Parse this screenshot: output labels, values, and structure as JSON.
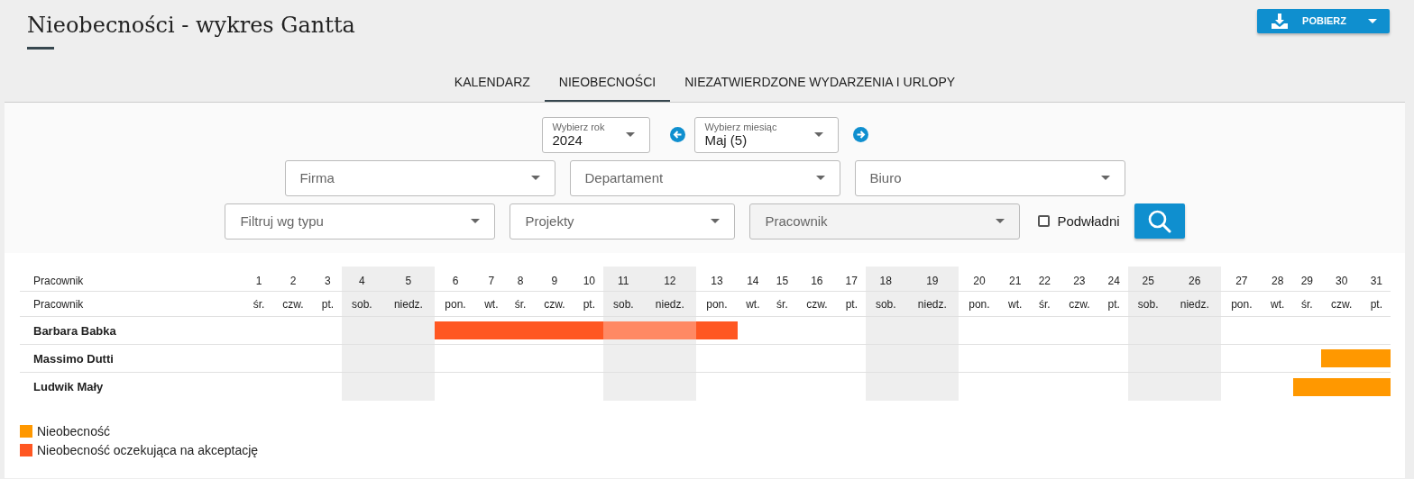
{
  "title": "Nieobecności - wykres Gantta",
  "download_button": {
    "label": "POBIERZ"
  },
  "tabs": [
    {
      "label": "KALENDARZ",
      "selected": false
    },
    {
      "label": "NIEOBECNOŚCI",
      "selected": true
    },
    {
      "label": "NIEZATWIERDZONE WYDARZENIA I URLOPY",
      "selected": false
    }
  ],
  "period": {
    "year": {
      "label": "Wybierz rok",
      "value": "2024"
    },
    "month": {
      "label": "Wybierz miesiąc",
      "value": "Maj (5)"
    }
  },
  "filters": [
    [
      {
        "placeholder": "Firma",
        "disabled": false
      },
      {
        "placeholder": "Departament",
        "disabled": false
      },
      {
        "placeholder": "Biuro",
        "disabled": false
      }
    ],
    [
      {
        "placeholder": "Filtruj wg typu",
        "disabled": false
      },
      {
        "placeholder": "Projekty",
        "disabled": false
      },
      {
        "placeholder": "Pracownik",
        "disabled": true
      }
    ]
  ],
  "subordinates": {
    "label": "Podwładni",
    "checked": false
  },
  "gantt": {
    "header_1": "Pracownik",
    "header_2": "Pracownik",
    "days": [
      {
        "day": "1",
        "weekday": "śr.",
        "weekend": false
      },
      {
        "day": "2",
        "weekday": "czw.",
        "weekend": false
      },
      {
        "day": "3",
        "weekday": "pt.",
        "weekend": false
      },
      {
        "day": "4",
        "weekday": "sob.",
        "weekend": true
      },
      {
        "day": "5",
        "weekday": "niedz.",
        "weekend": true
      },
      {
        "day": "6",
        "weekday": "pon.",
        "weekend": false
      },
      {
        "day": "7",
        "weekday": "wt.",
        "weekend": false
      },
      {
        "day": "8",
        "weekday": "śr.",
        "weekend": false
      },
      {
        "day": "9",
        "weekday": "czw.",
        "weekend": false
      },
      {
        "day": "10",
        "weekday": "pt.",
        "weekend": false
      },
      {
        "day": "11",
        "weekday": "sob.",
        "weekend": true
      },
      {
        "day": "12",
        "weekday": "niedz.",
        "weekend": true
      },
      {
        "day": "13",
        "weekday": "pon.",
        "weekend": false
      },
      {
        "day": "14",
        "weekday": "wt.",
        "weekend": false
      },
      {
        "day": "15",
        "weekday": "śr.",
        "weekend": false
      },
      {
        "day": "16",
        "weekday": "czw.",
        "weekend": false
      },
      {
        "day": "17",
        "weekday": "pt.",
        "weekend": false
      },
      {
        "day": "18",
        "weekday": "sob.",
        "weekend": true
      },
      {
        "day": "19",
        "weekday": "niedz.",
        "weekend": true
      },
      {
        "day": "20",
        "weekday": "pon.",
        "weekend": false
      },
      {
        "day": "21",
        "weekday": "wt.",
        "weekend": false
      },
      {
        "day": "22",
        "weekday": "śr.",
        "weekend": false
      },
      {
        "day": "23",
        "weekday": "czw.",
        "weekend": false
      },
      {
        "day": "24",
        "weekday": "pt.",
        "weekend": false
      },
      {
        "day": "25",
        "weekday": "sob.",
        "weekend": true
      },
      {
        "day": "26",
        "weekday": "niedz.",
        "weekend": true
      },
      {
        "day": "27",
        "weekday": "pon.",
        "weekend": false
      },
      {
        "day": "28",
        "weekday": "wt.",
        "weekend": false
      },
      {
        "day": "29",
        "weekday": "śr.",
        "weekend": false
      },
      {
        "day": "30",
        "weekday": "czw.",
        "weekend": false
      },
      {
        "day": "31",
        "weekday": "pt.",
        "weekend": false
      }
    ],
    "employees": [
      {
        "name": "Barbara Babka",
        "color": "#ff5722",
        "days": [
          {
            "absent": false
          },
          {
            "absent": false
          },
          {
            "absent": false
          },
          {
            "absent": false
          },
          {
            "absent": false
          },
          {
            "absent": true
          },
          {
            "absent": true
          },
          {
            "absent": true
          },
          {
            "absent": true
          },
          {
            "absent": true
          },
          {
            "absent": true
          },
          {
            "absent": true
          },
          {
            "absent": true
          },
          {
            "absent": false
          },
          {
            "absent": false
          },
          {
            "absent": false
          },
          {
            "absent": false
          },
          {
            "absent": false
          },
          {
            "absent": false
          },
          {
            "absent": false
          },
          {
            "absent": false
          },
          {
            "absent": false
          },
          {
            "absent": false
          },
          {
            "absent": false
          },
          {
            "absent": false
          },
          {
            "absent": false
          },
          {
            "absent": false
          },
          {
            "absent": false
          },
          {
            "absent": false
          },
          {
            "absent": false
          },
          {
            "absent": false
          }
        ]
      },
      {
        "name": "Massimo Dutti",
        "color": "#ff9800",
        "days": [
          {
            "absent": false
          },
          {
            "absent": false
          },
          {
            "absent": false
          },
          {
            "absent": false
          },
          {
            "absent": false
          },
          {
            "absent": false
          },
          {
            "absent": false
          },
          {
            "absent": false
          },
          {
            "absent": false
          },
          {
            "absent": false
          },
          {
            "absent": false
          },
          {
            "absent": false
          },
          {
            "absent": false
          },
          {
            "absent": false
          },
          {
            "absent": false
          },
          {
            "absent": false
          },
          {
            "absent": false
          },
          {
            "absent": false
          },
          {
            "absent": false
          },
          {
            "absent": false
          },
          {
            "absent": false
          },
          {
            "absent": false
          },
          {
            "absent": false
          },
          {
            "absent": false
          },
          {
            "absent": false
          },
          {
            "absent": false
          },
          {
            "absent": false
          },
          {
            "absent": false
          },
          {
            "absent": false
          },
          {
            "absent": true
          },
          {
            "absent": true
          }
        ]
      },
      {
        "name": "Ludwik Mały",
        "color": "#ff9800",
        "days": [
          {
            "absent": false
          },
          {
            "absent": false
          },
          {
            "absent": false
          },
          {
            "absent": false
          },
          {
            "absent": false
          },
          {
            "absent": false
          },
          {
            "absent": false
          },
          {
            "absent": false
          },
          {
            "absent": false
          },
          {
            "absent": false
          },
          {
            "absent": false
          },
          {
            "absent": false
          },
          {
            "absent": false
          },
          {
            "absent": false
          },
          {
            "absent": false
          },
          {
            "absent": false
          },
          {
            "absent": false
          },
          {
            "absent": false
          },
          {
            "absent": false
          },
          {
            "absent": false
          },
          {
            "absent": false
          },
          {
            "absent": false
          },
          {
            "absent": false
          },
          {
            "absent": false
          },
          {
            "absent": false
          },
          {
            "absent": false
          },
          {
            "absent": false
          },
          {
            "absent": false
          },
          {
            "absent": true
          },
          {
            "absent": true
          },
          {
            "absent": true
          }
        ]
      }
    ]
  },
  "legend": [
    {
      "label": "Nieobecność",
      "color": "#ff9800"
    },
    {
      "label": "Nieobecność oczekująca na akceptację",
      "color": "#ff5722"
    }
  ]
}
